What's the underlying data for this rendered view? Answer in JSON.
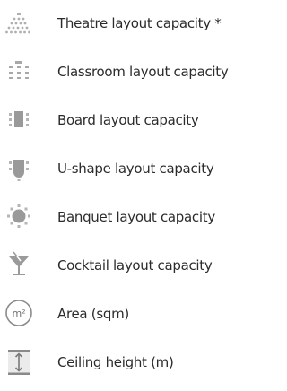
{
  "legend": {
    "items": [
      {
        "icon": "theatre-layout-icon",
        "label": "Theatre layout capacity *"
      },
      {
        "icon": "classroom-layout-icon",
        "label": "Classroom layout capacity"
      },
      {
        "icon": "board-layout-icon",
        "label": "Board layout capacity"
      },
      {
        "icon": "u-shape-layout-icon",
        "label": "U-shape layout capacity"
      },
      {
        "icon": "banquet-layout-icon",
        "label": "Banquet layout capacity"
      },
      {
        "icon": "cocktail-layout-icon",
        "label": "Cocktail layout capacity"
      },
      {
        "icon": "area-sqm-icon",
        "label": "Area (sqm)",
        "icon_text": "m²"
      },
      {
        "icon": "ceiling-height-icon",
        "label": "Ceiling height (m)"
      }
    ]
  },
  "colors": {
    "icon": "#9a9a9a",
    "icon_light": "#c4c4c4",
    "text": "#2b2b2b"
  }
}
